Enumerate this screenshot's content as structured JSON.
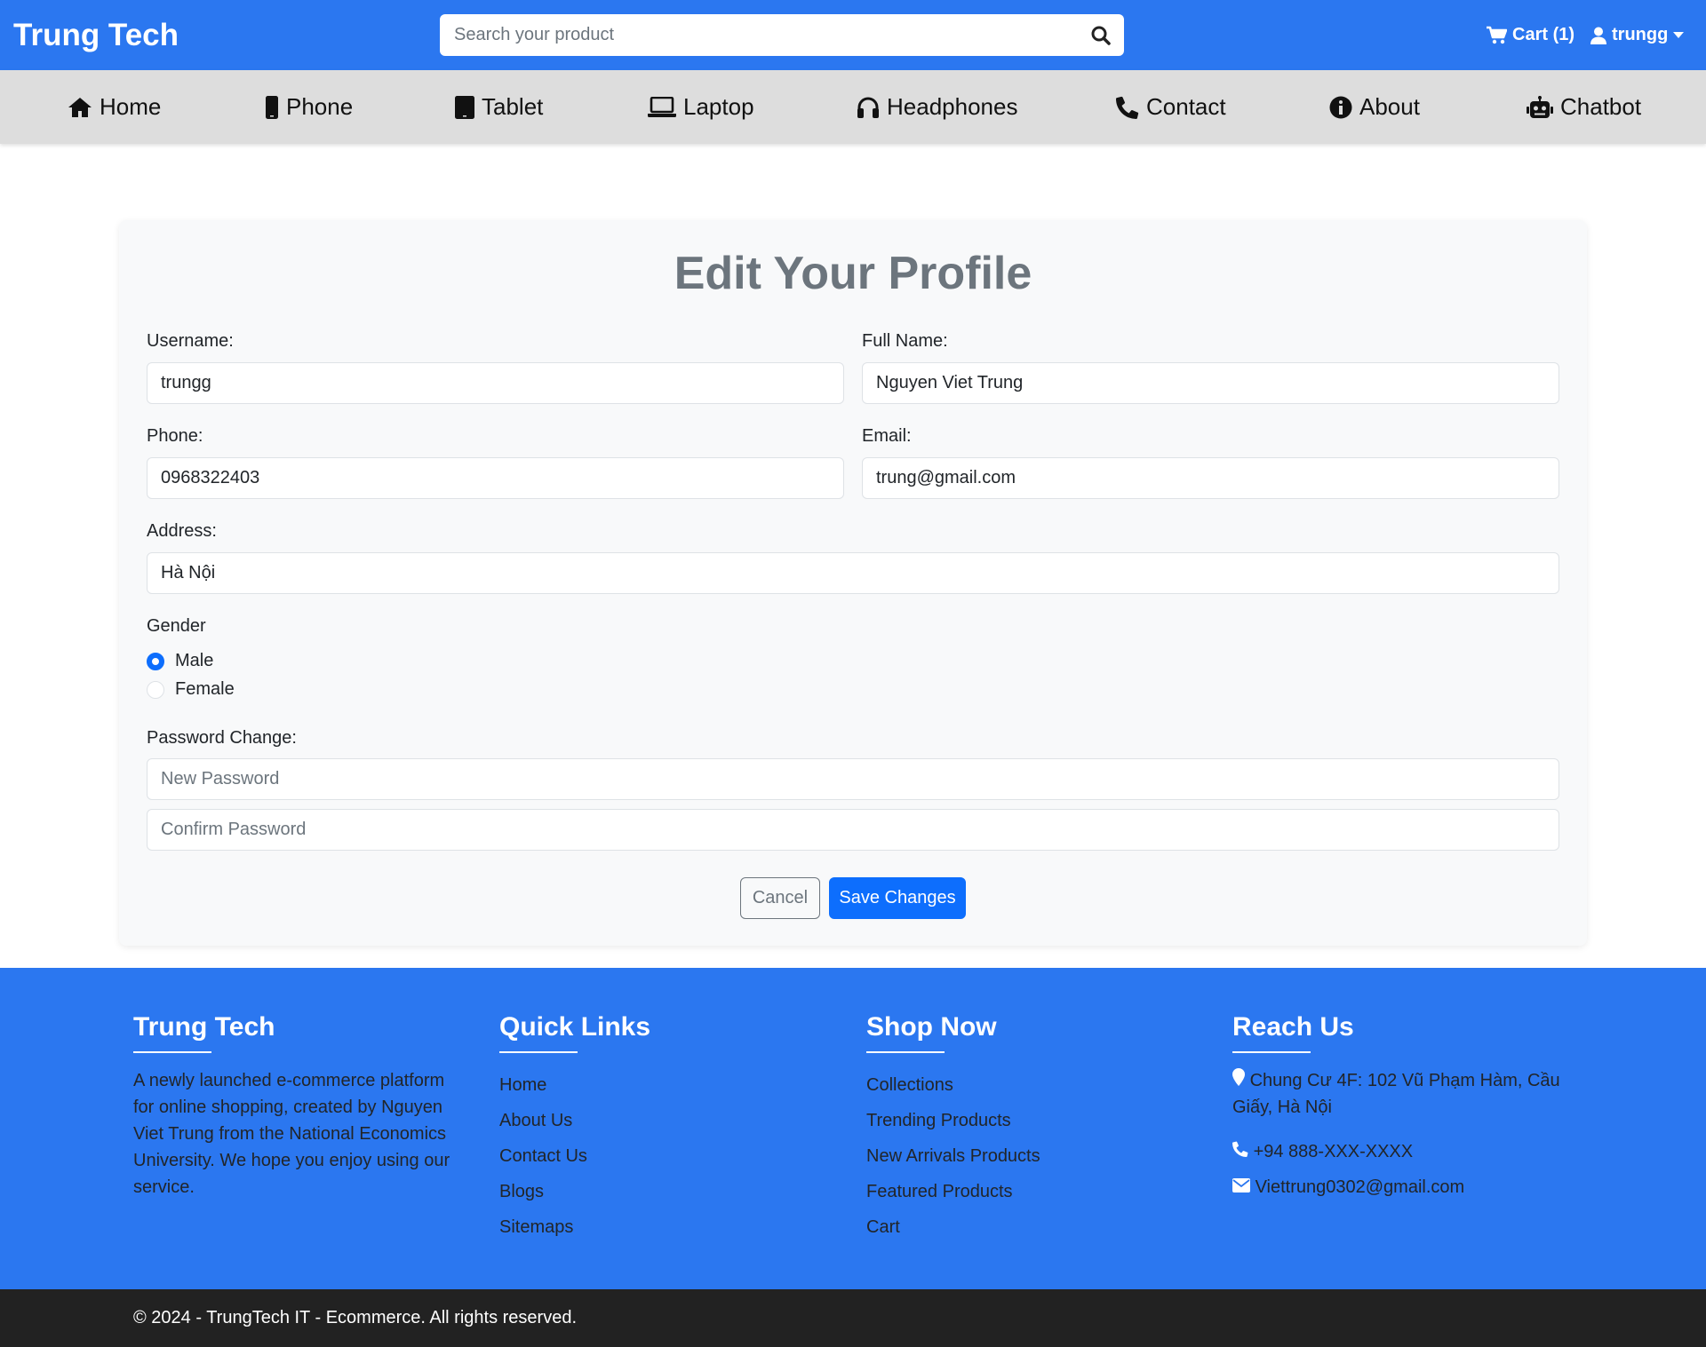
{
  "header": {
    "brand": "Trung Tech",
    "search_placeholder": "Search your product",
    "cart_label": "Cart (1)",
    "user_label": "trungg"
  },
  "nav": {
    "items": [
      {
        "label": "Home",
        "icon": "home-icon"
      },
      {
        "label": "Phone",
        "icon": "phone-icon"
      },
      {
        "label": "Tablet",
        "icon": "tablet-icon"
      },
      {
        "label": "Laptop",
        "icon": "laptop-icon"
      },
      {
        "label": "Headphones",
        "icon": "headphones-icon"
      },
      {
        "label": "Contact",
        "icon": "telephone-icon"
      },
      {
        "label": "About",
        "icon": "info-icon"
      },
      {
        "label": "Chatbot",
        "icon": "robot-icon"
      }
    ]
  },
  "profile": {
    "title": "Edit Your Profile",
    "username_label": "Username:",
    "username_value": "trungg",
    "fullname_label": "Full Name:",
    "fullname_value": "Nguyen Viet Trung",
    "phone_label": "Phone:",
    "phone_value": "0968322403",
    "email_label": "Email:",
    "email_value": "trung@gmail.com",
    "address_label": "Address:",
    "address_value": "Hà Nội",
    "gender_label": "Gender",
    "gender_options": [
      {
        "label": "Male",
        "checked": true
      },
      {
        "label": "Female",
        "checked": false
      }
    ],
    "password_label": "Password Change:",
    "new_password_placeholder": "New Password",
    "confirm_password_placeholder": "Confirm Password",
    "cancel_label": "Cancel",
    "save_label": "Save Changes"
  },
  "footer": {
    "about": {
      "title": "Trung Tech",
      "text": "A newly launched e-commerce platform for online shopping, created by Nguyen Viet Trung from the National Economics University. We hope you enjoy using our service."
    },
    "quick_links": {
      "title": "Quick Links",
      "items": [
        "Home",
        "About Us",
        "Contact Us",
        "Blogs",
        "Sitemaps"
      ]
    },
    "shop_now": {
      "title": "Shop Now",
      "items": [
        "Collections",
        "Trending Products",
        "New Arrivals Products",
        "Featured Products",
        "Cart"
      ]
    },
    "reach_us": {
      "title": "Reach Us",
      "address": "Chung Cư 4F: 102 Vũ Phạm Hàm, Cầu Giấy, Hà Nội",
      "phone": "+94 888-XXX-XXXX",
      "email": "Viettrung0302@gmail.com"
    },
    "copyright": "© 2024 - TrungTech IT - Ecommerce. All rights reserved."
  },
  "colors": {
    "primary_blue": "#2b77f0",
    "button_blue": "#0d6efd",
    "nav_gray": "#dddddd",
    "footer_dark": "#222222"
  }
}
